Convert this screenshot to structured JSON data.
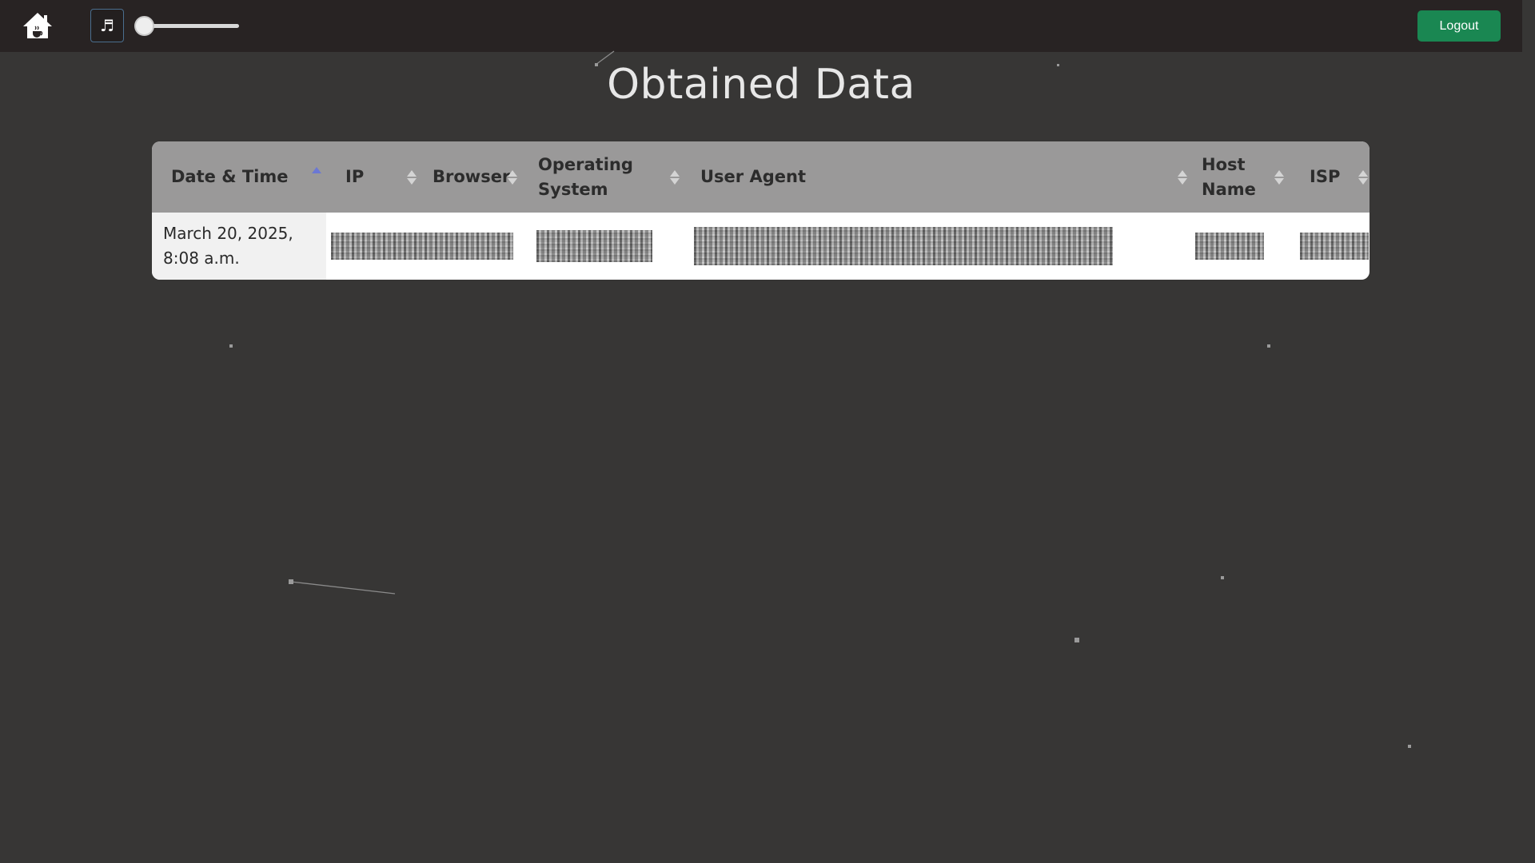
{
  "navbar": {
    "home_icon": "house-icon",
    "music_icon_glyph": "♬",
    "volume": 0,
    "logout_label": "Logout",
    "logout_color": "#1a8752"
  },
  "page": {
    "title": "Obtained Data"
  },
  "table": {
    "columns": [
      {
        "label": "Date & Time",
        "sort": "ascending"
      },
      {
        "label": "IP",
        "sort": "none"
      },
      {
        "label": "Browser",
        "sort": "none"
      },
      {
        "label": "Operating System",
        "sort": "none"
      },
      {
        "label": "User Agent",
        "sort": "none"
      },
      {
        "label": "Host Name",
        "sort": "none"
      },
      {
        "label": "ISP",
        "sort": "none"
      }
    ],
    "rows": [
      {
        "date_time": "March 20, 2025, 8:08 a.m."
      }
    ]
  }
}
